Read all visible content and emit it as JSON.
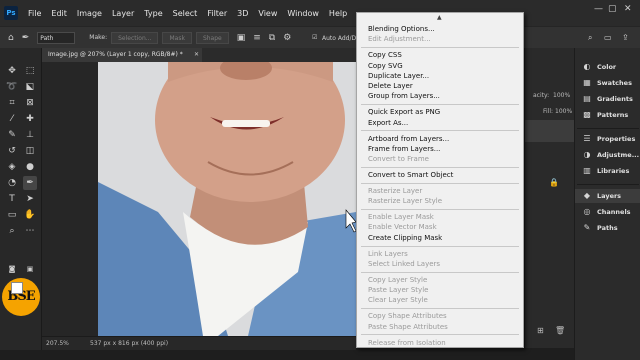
{
  "app": {
    "logo_text": "Ps"
  },
  "menubar": {
    "items": [
      "File",
      "Edit",
      "Image",
      "Layer",
      "Type",
      "Select",
      "Filter",
      "3D",
      "View",
      "Window",
      "Help"
    ]
  },
  "options_bar": {
    "mode_value": "Path",
    "make_label": "Make:",
    "selection_btn": "Selection...",
    "mask_btn": "Mask",
    "shape_btn": "Shape",
    "auto_add_label": "Auto Add/De"
  },
  "document": {
    "tab_title": "Image.jpg @ 207% (Layer 1 copy, RGB/8#) *",
    "zoom": "207.5%",
    "size_info": "537 px x 816 px (400 ppi)"
  },
  "right_dock": {
    "opacity_label": "acity:",
    "opacity_value": "100%",
    "fill_label": "Fill:",
    "fill_value": "100%"
  },
  "panels": {
    "group1": [
      "Color",
      "Swatches",
      "Gradients",
      "Patterns"
    ],
    "group2": [
      "Properties",
      "Adjustme...",
      "Libraries"
    ],
    "group3": [
      "Layers",
      "Channels",
      "Paths"
    ],
    "active": "Layers"
  },
  "context_menu": {
    "arrow": "▲",
    "groups": [
      [
        {
          "label": "Blending Options...",
          "enabled": true
        },
        {
          "label": "Edit Adjustment...",
          "enabled": false
        }
      ],
      [
        {
          "label": "Copy CSS",
          "enabled": true
        },
        {
          "label": "Copy SVG",
          "enabled": true
        },
        {
          "label": "Duplicate Layer...",
          "enabled": true
        },
        {
          "label": "Delete Layer",
          "enabled": true
        },
        {
          "label": "Group from Layers...",
          "enabled": true
        }
      ],
      [
        {
          "label": "Quick Export as PNG",
          "enabled": true
        },
        {
          "label": "Export As...",
          "enabled": true
        }
      ],
      [
        {
          "label": "Artboard from Layers...",
          "enabled": true
        },
        {
          "label": "Frame from Layers...",
          "enabled": true
        },
        {
          "label": "Convert to Frame",
          "enabled": false
        }
      ],
      [
        {
          "label": "Convert to Smart Object",
          "enabled": true
        }
      ],
      [
        {
          "label": "Rasterize Layer",
          "enabled": false
        },
        {
          "label": "Rasterize Layer Style",
          "enabled": false
        }
      ],
      [
        {
          "label": "Enable Layer Mask",
          "enabled": false
        },
        {
          "label": "Enable Vector Mask",
          "enabled": false
        },
        {
          "label": "Create Clipping Mask",
          "enabled": true
        }
      ],
      [
        {
          "label": "Link Layers",
          "enabled": false
        },
        {
          "label": "Select Linked Layers",
          "enabled": false
        }
      ],
      [
        {
          "label": "Copy Layer Style",
          "enabled": false
        },
        {
          "label": "Paste Layer Style",
          "enabled": false
        },
        {
          "label": "Clear Layer Style",
          "enabled": false
        }
      ],
      [
        {
          "label": "Copy Shape Attributes",
          "enabled": false
        },
        {
          "label": "Paste Shape Attributes",
          "enabled": false
        }
      ],
      [
        {
          "label": "Release from Isolation",
          "enabled": false
        }
      ]
    ]
  },
  "colors": {
    "fg": "#ffffff",
    "bg": "#000000",
    "menu_bg": "#f0f0f0",
    "disabled": "#9a9a9a",
    "logo_orange": "#f5a300"
  },
  "watermark": {
    "text": "BSE"
  }
}
